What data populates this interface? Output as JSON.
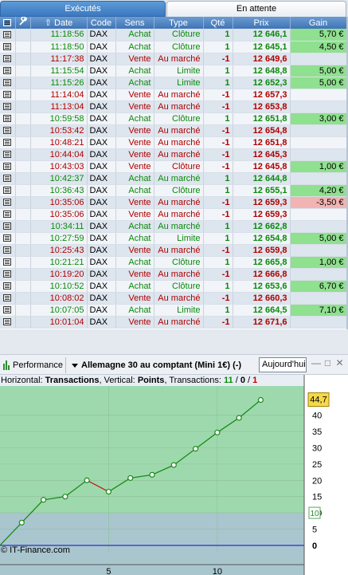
{
  "tabs": {
    "executed": "Exécutés",
    "pending": "En attente"
  },
  "table": {
    "headers": {
      "date": "Date",
      "code": "Code",
      "sens": "Sens",
      "type": "Type",
      "qty": "Qté",
      "price": "Prix",
      "gain": "Gain"
    },
    "rows": [
      {
        "time": "11:18:56",
        "code": "DAX",
        "sens": "Achat",
        "type": "Clôture",
        "qty": "1",
        "price": "12 646,1",
        "gain": "5,70 €"
      },
      {
        "time": "11:18:50",
        "code": "DAX",
        "sens": "Achat",
        "type": "Clôture",
        "qty": "1",
        "price": "12 645,1",
        "gain": "4,50 €"
      },
      {
        "time": "11:17:38",
        "code": "DAX",
        "sens": "Vente",
        "type": "Au marché",
        "qty": "-1",
        "price": "12 649,6",
        "gain": ""
      },
      {
        "time": "11:15:54",
        "code": "DAX",
        "sens": "Achat",
        "type": "Limite",
        "qty": "1",
        "price": "12 648,8",
        "gain": "5,00 €"
      },
      {
        "time": "11:15:26",
        "code": "DAX",
        "sens": "Achat",
        "type": "Limite",
        "qty": "1",
        "price": "12 652,3",
        "gain": "5,00 €"
      },
      {
        "time": "11:14:04",
        "code": "DAX",
        "sens": "Vente",
        "type": "Au marché",
        "qty": "-1",
        "price": "12 657,3",
        "gain": ""
      },
      {
        "time": "11:13:04",
        "code": "DAX",
        "sens": "Vente",
        "type": "Au marché",
        "qty": "-1",
        "price": "12 653,8",
        "gain": ""
      },
      {
        "time": "10:59:58",
        "code": "DAX",
        "sens": "Achat",
        "type": "Clôture",
        "qty": "1",
        "price": "12 651,8",
        "gain": "3,00 €"
      },
      {
        "time": "10:53:42",
        "code": "DAX",
        "sens": "Vente",
        "type": "Au marché",
        "qty": "-1",
        "price": "12 654,8",
        "gain": ""
      },
      {
        "time": "10:48:21",
        "code": "DAX",
        "sens": "Vente",
        "type": "Au marché",
        "qty": "-1",
        "price": "12 651,8",
        "gain": ""
      },
      {
        "time": "10:44:04",
        "code": "DAX",
        "sens": "Vente",
        "type": "Au marché",
        "qty": "-1",
        "price": "12 645,3",
        "gain": ""
      },
      {
        "time": "10:43:03",
        "code": "DAX",
        "sens": "Vente",
        "type": "Clôture",
        "qty": "-1",
        "price": "12 645,8",
        "gain": "1,00 €"
      },
      {
        "time": "10:42:37",
        "code": "DAX",
        "sens": "Achat",
        "type": "Au marché",
        "qty": "1",
        "price": "12 644,8",
        "gain": ""
      },
      {
        "time": "10:36:43",
        "code": "DAX",
        "sens": "Achat",
        "type": "Clôture",
        "qty": "1",
        "price": "12 655,1",
        "gain": "4,20 €"
      },
      {
        "time": "10:35:06",
        "code": "DAX",
        "sens": "Vente",
        "type": "Au marché",
        "qty": "-1",
        "price": "12 659,3",
        "gain": "-3,50 €"
      },
      {
        "time": "10:35:06",
        "code": "DAX",
        "sens": "Vente",
        "type": "Au marché",
        "qty": "-1",
        "price": "12 659,3",
        "gain": ""
      },
      {
        "time": "10:34:11",
        "code": "DAX",
        "sens": "Achat",
        "type": "Au marché",
        "qty": "1",
        "price": "12 662,8",
        "gain": ""
      },
      {
        "time": "10:27:59",
        "code": "DAX",
        "sens": "Achat",
        "type": "Limite",
        "qty": "1",
        "price": "12 654,8",
        "gain": "5,00 €"
      },
      {
        "time": "10:25:43",
        "code": "DAX",
        "sens": "Vente",
        "type": "Au marché",
        "qty": "-1",
        "price": "12 659,8",
        "gain": ""
      },
      {
        "time": "10:21:21",
        "code": "DAX",
        "sens": "Achat",
        "type": "Clôture",
        "qty": "1",
        "price": "12 665,8",
        "gain": "1,00 €"
      },
      {
        "time": "10:19:20",
        "code": "DAX",
        "sens": "Vente",
        "type": "Au marché",
        "qty": "-1",
        "price": "12 666,8",
        "gain": ""
      },
      {
        "time": "10:10:52",
        "code": "DAX",
        "sens": "Achat",
        "type": "Clôture",
        "qty": "1",
        "price": "12 653,6",
        "gain": "6,70 €"
      },
      {
        "time": "10:08:02",
        "code": "DAX",
        "sens": "Vente",
        "type": "Au marché",
        "qty": "-1",
        "price": "12 660,3",
        "gain": ""
      },
      {
        "time": "10:07:05",
        "code": "DAX",
        "sens": "Achat",
        "type": "Limite",
        "qty": "1",
        "price": "12 664,5",
        "gain": "7,10 €"
      },
      {
        "time": "10:01:04",
        "code": "DAX",
        "sens": "Vente",
        "type": "Au marché",
        "qty": "-1",
        "price": "12 671,6",
        "gain": ""
      }
    ]
  },
  "toolbar": {
    "performance": "Performance",
    "instrument": "Allemagne 30 au comptant (Mini 1€) (-)",
    "period": "Aujourd'hui"
  },
  "chart_info": {
    "horizontal_label": "Horizontal:",
    "horizontal_value": "Transactions",
    "vertical_label": ", Vertical:",
    "vertical_value": "Points",
    "transactions_label": ", Transactions:",
    "wins": "11",
    "sep1": " / ",
    "neutral": "0",
    "sep2": " / ",
    "losses": "1"
  },
  "copyright": "© IT-Finance.com",
  "colors": {
    "buy": "#0b8a0b",
    "sell": "#b00000",
    "gain_positive": "#8fe08f",
    "gain_negative": "#f2b3b3",
    "curve": "#1a8a1a",
    "curve_down": "#c02020"
  },
  "chart_data": {
    "type": "line",
    "x": [
      0,
      1,
      2,
      3,
      4,
      5,
      6,
      7,
      8,
      9,
      10,
      11,
      12
    ],
    "y": [
      0,
      7,
      14,
      15,
      20,
      16.5,
      20.7,
      21.7,
      24.7,
      29.7,
      34.7,
      39.2,
      44.7
    ],
    "xlim": [
      0,
      14
    ],
    "ylim": [
      -2,
      49
    ],
    "xticks": [
      5,
      10
    ],
    "yticks": [
      0,
      5,
      10,
      15,
      20,
      25,
      30,
      35,
      40
    ],
    "last_value_label": "44,7",
    "threshold_label": "10",
    "threshold": 10
  }
}
